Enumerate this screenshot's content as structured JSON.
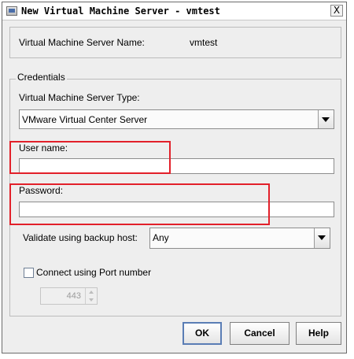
{
  "window": {
    "title": "New Virtual Machine Server - vmtest",
    "close_glyph": "X"
  },
  "server_name": {
    "label": "Virtual Machine Server Name:",
    "value": "vmtest"
  },
  "credentials": {
    "legend": "Credentials",
    "server_type": {
      "label": "Virtual Machine Server Type:",
      "value": "VMware Virtual Center Server"
    },
    "username": {
      "label": "User name:",
      "value": ""
    },
    "password": {
      "label": "Password:",
      "value": ""
    },
    "backup_host": {
      "label": "Validate using backup host:",
      "value": "Any"
    },
    "port": {
      "checkbox_label": "Connect using Port number",
      "checked": false,
      "value": "443"
    }
  },
  "buttons": {
    "ok": "OK",
    "cancel": "Cancel",
    "help": "Help"
  },
  "colors": {
    "highlight_box": "#e2202a",
    "default_button_border": "#5a7db5"
  }
}
